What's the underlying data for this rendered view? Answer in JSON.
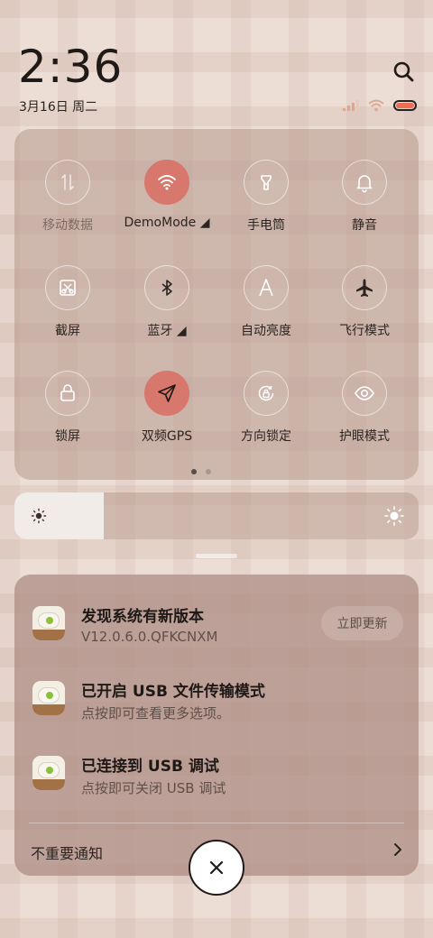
{
  "status_bar": {
    "time": "2:36",
    "date": "3月16日 周二",
    "battery_color": "#ee6e52"
  },
  "quick_settings": {
    "tiles": [
      {
        "label": "移动数据",
        "icon": "mobile-data-icon",
        "active": false,
        "dim": true
      },
      {
        "label": "DemoMode ◢",
        "icon": "wifi-icon",
        "active": true
      },
      {
        "label": "手电筒",
        "icon": "flashlight-icon",
        "active": false
      },
      {
        "label": "静音",
        "icon": "bell-icon",
        "active": false
      },
      {
        "label": "截屏",
        "icon": "screenshot-icon",
        "active": false
      },
      {
        "label": "蓝牙 ◢",
        "icon": "bluetooth-icon",
        "active": false
      },
      {
        "label": "自动亮度",
        "icon": "auto-brightness-icon",
        "active": false
      },
      {
        "label": "飞行模式",
        "icon": "airplane-icon",
        "active": false
      },
      {
        "label": "锁屏",
        "icon": "lock-icon",
        "active": false
      },
      {
        "label": "双频GPS",
        "icon": "location-icon",
        "active": true
      },
      {
        "label": "方向锁定",
        "icon": "rotation-lock-icon",
        "active": false
      },
      {
        "label": "护眼模式",
        "icon": "eye-icon",
        "active": false
      }
    ],
    "page_count": 2,
    "current_page": 1,
    "active_color": "#d8786c"
  },
  "brightness": {
    "level": 0.22
  },
  "notifications": {
    "items": [
      {
        "title": "发现系统有新版本",
        "subtitle": "V12.0.6.0.QFKCNXM",
        "action": "立即更新"
      },
      {
        "title": "已开启 USB 文件传输模式",
        "subtitle": "点按即可查看更多选项。"
      },
      {
        "title": "已连接到 USB 调试",
        "subtitle": "点按即可关闭 USB 调试"
      }
    ],
    "unimportant_label": "不重要通知"
  }
}
